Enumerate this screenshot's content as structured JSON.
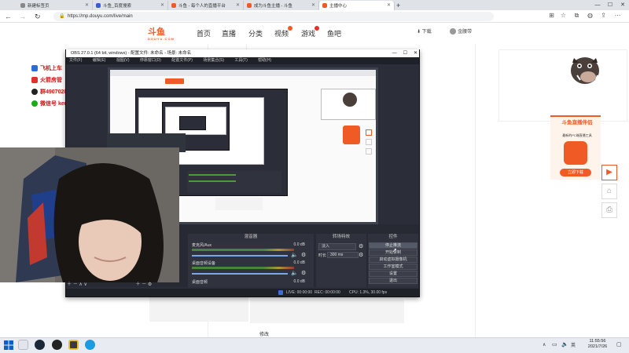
{
  "browser": {
    "tabs": [
      {
        "label": "新建标签页"
      },
      {
        "label": "斗鱼_百度搜索"
      },
      {
        "label": "斗鱼 - 每个人的直播平台"
      },
      {
        "label": "成为斗鱼主播 - 斗鱼"
      },
      {
        "label": "主播中心",
        "active": true
      }
    ],
    "url": "https://mp.douyu.com/live/main"
  },
  "douyu": {
    "logo": "斗鱼",
    "logo_sub": "DOUYU.COM",
    "nav": [
      "首页",
      "直播",
      "分类",
      "视频",
      "游戏",
      "鱼吧"
    ],
    "download": "下载",
    "user": "金腰带"
  },
  "page": {
    "edit_link": "修改"
  },
  "ad": {
    "lines": [
      "飞机上车",
      "火箭房管",
      "群490702036",
      "微信号 kenwashianji"
    ],
    "icon_colors": [
      "#2b6cd6",
      "#e0312b",
      "#222222",
      "#1aad19"
    ]
  },
  "promo": {
    "title": "斗鱼直播伴侣",
    "subtitle": "最新的PC端直播工具",
    "button": "立即下载"
  },
  "obs": {
    "title": "OBS 27.0.1 (64 bit, windows) - 配置文件: 未命名 - 场景: 未命名",
    "menu": [
      "文件(F)",
      "编辑(E)",
      "视图(V)",
      "停靠窗口(D)",
      "配置文件(P)",
      "场景集合(S)",
      "工具(T)",
      "帮助(H)"
    ],
    "dock_titles": {
      "mixer": "混音器",
      "transitions": "转场特效",
      "controls": "控件"
    },
    "mixer_rows": [
      {
        "name": "麦克风/Aux",
        "db": "0.0 dB"
      },
      {
        "name": "桌面音频设备",
        "db": "0.0 dB"
      },
      {
        "name": "桌面音频",
        "db": "0.0 dB"
      }
    ],
    "transition": {
      "value": "淡入",
      "duration_label": "时长",
      "duration": "300 ms"
    },
    "controls": [
      "停止推流",
      "开始录制",
      "启动虚拟摄像机",
      "工作室模式",
      "设置",
      "退出"
    ],
    "status": {
      "live": "LIVE: 00:00:00",
      "rec": "REC: 00:00:00",
      "cpu": "CPU: 1.3%, 30.00 fps"
    }
  },
  "taskbar": {
    "time": "11:55:56",
    "date": "2021/7/26"
  }
}
